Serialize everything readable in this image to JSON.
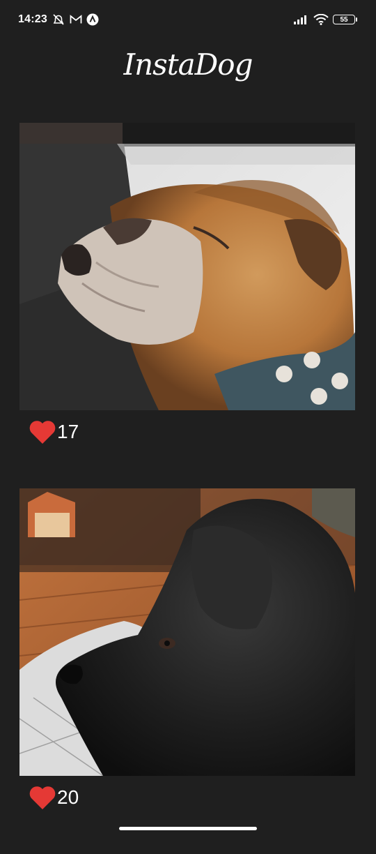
{
  "status_bar": {
    "time": "14:23",
    "battery": "55",
    "icons": [
      "muted-alarm-icon",
      "gmail-icon",
      "app-notification-icon",
      "signal-icon",
      "wifi-icon",
      "battery-icon"
    ]
  },
  "app": {
    "title": "InstaDog"
  },
  "posts": [
    {
      "likes": "17",
      "image": "english-bulldog-photo",
      "icon": "heart-icon"
    },
    {
      "likes": "20",
      "image": "black-dog-photo",
      "icon": "heart-icon"
    }
  ],
  "colors": {
    "background": "#1f1f1f",
    "heart": "#e53935",
    "text": "#ffffff"
  }
}
